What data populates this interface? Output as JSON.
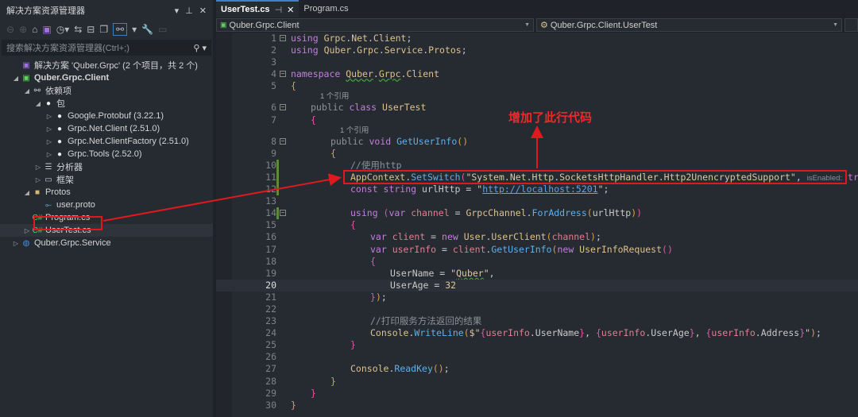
{
  "panel": {
    "title": "解决方案资源管理器",
    "search_placeholder": "搜索解决方案资源管理器(Ctrl+;)",
    "tree": [
      {
        "label": "解决方案 'Quber.Grpc' (2 个项目，共 2 个)",
        "icon": "solution-icon",
        "level": 0,
        "arrow": ""
      },
      {
        "label": "Quber.Grpc.Client",
        "icon": "csharp-project-icon",
        "level": 0,
        "arrow": "◢",
        "bold": true
      },
      {
        "label": "依赖项",
        "icon": "dependencies-icon",
        "level": 1,
        "arrow": "◢"
      },
      {
        "label": "包",
        "icon": "package-icon",
        "level": 2,
        "arrow": "◢"
      },
      {
        "label": "Google.Protobuf (3.22.1)",
        "icon": "package-icon",
        "level": 3,
        "arrow": "▷"
      },
      {
        "label": "Grpc.Net.Client (2.51.0)",
        "icon": "package-icon",
        "level": 3,
        "arrow": "▷"
      },
      {
        "label": "Grpc.Net.ClientFactory (2.51.0)",
        "icon": "package-icon",
        "level": 3,
        "arrow": "▷"
      },
      {
        "label": "Grpc.Tools (2.52.0)",
        "icon": "package-icon",
        "level": 3,
        "arrow": "▷"
      },
      {
        "label": "分析器",
        "icon": "analyzer-icon",
        "level": 2,
        "arrow": "▷"
      },
      {
        "label": "框架",
        "icon": "framework-icon",
        "level": 2,
        "arrow": "▷"
      },
      {
        "label": "Protos",
        "icon": "folder-icon",
        "level": 1,
        "arrow": "◢"
      },
      {
        "label": "user.proto",
        "icon": "proto-file-icon",
        "level": 2,
        "arrow": ""
      },
      {
        "label": "Program.cs",
        "icon": "csharp-file-icon",
        "level": 1,
        "arrow": ""
      },
      {
        "label": "UserTest.cs",
        "icon": "csharp-file-icon",
        "level": 1,
        "arrow": "▷",
        "selected": true
      },
      {
        "label": "Quber.Grpc.Service",
        "icon": "web-project-icon",
        "level": 0,
        "arrow": "▷"
      }
    ]
  },
  "tabs": [
    {
      "label": "UserTest.cs",
      "active": true
    },
    {
      "label": "Program.cs"
    }
  ],
  "nav": {
    "project": "Quber.Grpc.Client",
    "type": "Quber.Grpc.Client.UserTest"
  },
  "codelens": "1 个引用",
  "annotation": "增加了此行代码",
  "colors": {
    "annotation": "#e0191e",
    "background": "#262a31"
  },
  "code": [
    {
      "n": 1,
      "i": 0,
      "f": 1,
      "tk": [
        [
          "k",
          "using"
        ],
        [
          "n",
          " "
        ],
        [
          "t",
          "Grpc"
        ],
        [
          "n",
          "."
        ],
        [
          "t",
          "Net"
        ],
        [
          "n",
          "."
        ],
        [
          "t",
          "Client"
        ],
        [
          "n",
          ";"
        ]
      ]
    },
    {
      "n": 2,
      "i": 0,
      "tk": [
        [
          "k",
          "using"
        ],
        [
          "n",
          " "
        ],
        [
          "t",
          "Quber"
        ],
        [
          "n",
          "."
        ],
        [
          "t",
          "Grpc"
        ],
        [
          "n",
          "."
        ],
        [
          "t",
          "Service"
        ],
        [
          "n",
          "."
        ],
        [
          "t",
          "Protos"
        ],
        [
          "n",
          ";"
        ]
      ]
    },
    {
      "n": 3,
      "i": 0,
      "tk": []
    },
    {
      "n": 4,
      "i": 0,
      "f": 1,
      "tk": [
        [
          "k",
          "namespace"
        ],
        [
          "n",
          " "
        ],
        [
          "t sq",
          "Quber"
        ],
        [
          "n",
          "."
        ],
        [
          "t sq",
          "Grpc"
        ],
        [
          "n",
          "."
        ],
        [
          "t",
          "Client"
        ]
      ]
    },
    {
      "n": 5,
      "i": 0,
      "tk": [
        [
          "b1",
          "{"
        ]
      ]
    },
    {
      "lens": 1,
      "i": 1
    },
    {
      "n": 6,
      "i": 1,
      "f": 1,
      "tk": [
        [
          "g",
          "public "
        ],
        [
          "k",
          "class "
        ],
        [
          "t",
          "UserTest"
        ]
      ]
    },
    {
      "n": 7,
      "i": 1,
      "tk": [
        [
          "b2",
          "{"
        ]
      ]
    },
    {
      "lens": 1,
      "i": 2
    },
    {
      "n": 8,
      "i": 2,
      "f": 1,
      "tk": [
        [
          "g",
          "public "
        ],
        [
          "k",
          "void "
        ],
        [
          "m",
          "GetUserInfo"
        ],
        [
          "b1",
          "()"
        ]
      ]
    },
    {
      "n": 9,
      "i": 2,
      "tk": [
        [
          "b1",
          "{"
        ]
      ]
    },
    {
      "n": 10,
      "i": 3,
      "chg": 1,
      "tk": [
        [
          "c",
          "//使用http"
        ]
      ]
    },
    {
      "n": 11,
      "i": 3,
      "chg": 1,
      "tk": [
        [
          "t",
          "AppContext"
        ],
        [
          "n",
          "."
        ],
        [
          "m",
          "SetSwitch"
        ],
        [
          "b2",
          "("
        ],
        [
          "s",
          "\"System.Net.Http.SocketsHttpHandler.Http2UnencryptedSupport\""
        ],
        [
          "n",
          ", "
        ],
        [
          "p",
          "isEnabled:"
        ],
        [
          "k",
          " true"
        ],
        [
          "b2",
          ")"
        ],
        [
          "n",
          ";"
        ]
      ]
    },
    {
      "n": 12,
      "i": 3,
      "chg": 1,
      "tk": [
        [
          "k",
          "const string "
        ],
        [
          "n",
          "urlHttp = "
        ],
        [
          "s",
          "\""
        ],
        [
          "u",
          "http://localhost:5201"
        ],
        [
          "s",
          "\""
        ],
        [
          "n",
          ";"
        ]
      ]
    },
    {
      "n": 13,
      "i": 3,
      "tk": []
    },
    {
      "n": 14,
      "i": 3,
      "chg": 1,
      "f": 1,
      "tk": [
        [
          "k",
          "using "
        ],
        [
          "b2",
          "("
        ],
        [
          "k",
          "var "
        ],
        [
          "v",
          "channel"
        ],
        [
          "n",
          " = "
        ],
        [
          "t",
          "GrpcChannel"
        ],
        [
          "n",
          "."
        ],
        [
          "m",
          "ForAddress"
        ],
        [
          "b1",
          "("
        ],
        [
          "n",
          "urlHttp"
        ],
        [
          "b1",
          ")"
        ],
        [
          "b2",
          ")"
        ]
      ]
    },
    {
      "n": 15,
      "i": 3,
      "tk": [
        [
          "b2",
          "{"
        ]
      ]
    },
    {
      "n": 16,
      "i": 4,
      "tk": [
        [
          "k",
          "var "
        ],
        [
          "v",
          "client"
        ],
        [
          "n",
          " = "
        ],
        [
          "k",
          "new "
        ],
        [
          "t",
          "User"
        ],
        [
          "n",
          "."
        ],
        [
          "t",
          "UserClient"
        ],
        [
          "b1",
          "("
        ],
        [
          "v",
          "channel"
        ],
        [
          "b1",
          ")"
        ],
        [
          "n",
          ";"
        ]
      ]
    },
    {
      "n": 17,
      "i": 4,
      "tk": [
        [
          "k",
          "var "
        ],
        [
          "v",
          "userInfo"
        ],
        [
          "n",
          " = "
        ],
        [
          "v",
          "client"
        ],
        [
          "n",
          "."
        ],
        [
          "m",
          "GetUserInfo"
        ],
        [
          "b1",
          "("
        ],
        [
          "k",
          "new "
        ],
        [
          "t",
          "UserInfoRequest"
        ],
        [
          "b2",
          "()"
        ]
      ]
    },
    {
      "n": 18,
      "i": 4,
      "tk": [
        [
          "b2",
          "{"
        ]
      ]
    },
    {
      "n": 19,
      "i": 5,
      "tk": [
        [
          "n",
          "UserName = "
        ],
        [
          "s",
          "\""
        ],
        [
          "s sq",
          "Quber"
        ],
        [
          "s",
          "\""
        ],
        [
          "n",
          ","
        ]
      ]
    },
    {
      "n": 20,
      "i": 5,
      "cur": 1,
      "tk": [
        [
          "n",
          "UserAge = "
        ],
        [
          "num",
          "32"
        ]
      ]
    },
    {
      "n": 21,
      "i": 4,
      "tk": [
        [
          "b2",
          "}"
        ],
        [
          "b1",
          ")"
        ],
        [
          "n",
          ";"
        ]
      ]
    },
    {
      "n": 22,
      "i": 4,
      "tk": []
    },
    {
      "n": 23,
      "i": 4,
      "tk": [
        [
          "c",
          "//打印服务方法返回的结果"
        ]
      ]
    },
    {
      "n": 24,
      "i": 4,
      "tk": [
        [
          "t",
          "Console"
        ],
        [
          "n",
          "."
        ],
        [
          "m",
          "WriteLine"
        ],
        [
          "b1",
          "("
        ],
        [
          "s",
          "$\""
        ],
        [
          "b2",
          "{"
        ],
        [
          "v",
          "userInfo"
        ],
        [
          "n",
          ".UserName"
        ],
        [
          "b2",
          "}"
        ],
        [
          "s",
          ", "
        ],
        [
          "b2",
          "{"
        ],
        [
          "v",
          "userInfo"
        ],
        [
          "n",
          ".UserAge"
        ],
        [
          "b2",
          "}"
        ],
        [
          "s",
          ", "
        ],
        [
          "b2",
          "{"
        ],
        [
          "v",
          "userInfo"
        ],
        [
          "n",
          ".Address"
        ],
        [
          "b2",
          "}"
        ],
        [
          "s",
          "\""
        ],
        [
          "b1",
          ")"
        ],
        [
          "n",
          ";"
        ]
      ]
    },
    {
      "n": 25,
      "i": 3,
      "tk": [
        [
          "b2",
          "}"
        ]
      ]
    },
    {
      "n": 26,
      "i": 3,
      "tk": []
    },
    {
      "n": 27,
      "i": 3,
      "tk": [
        [
          "t",
          "Console"
        ],
        [
          "n",
          "."
        ],
        [
          "m",
          "ReadKey"
        ],
        [
          "b1",
          "()"
        ],
        [
          "n",
          ";"
        ]
      ]
    },
    {
      "n": 28,
      "i": 2,
      "tk": [
        [
          "b1",
          "}"
        ]
      ]
    },
    {
      "n": 29,
      "i": 1,
      "tk": [
        [
          "b2",
          "}"
        ]
      ]
    },
    {
      "n": 30,
      "i": 0,
      "tk": [
        [
          "b1",
          "}"
        ]
      ]
    }
  ]
}
